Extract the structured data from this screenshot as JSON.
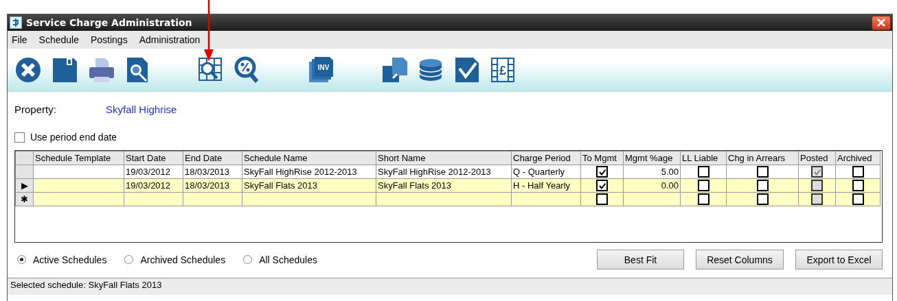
{
  "window": {
    "title": "Service Charge Administration"
  },
  "menu": [
    {
      "label": "File"
    },
    {
      "label": "Schedule"
    },
    {
      "label": "Postings"
    },
    {
      "label": "Administration"
    }
  ],
  "toolbar": [
    [
      {
        "kind": "close"
      },
      {
        "kind": "save"
      },
      {
        "kind": "print"
      },
      {
        "kind": "preview"
      }
    ],
    [
      {
        "kind": "grid-search"
      },
      {
        "kind": "percent-search"
      }
    ],
    [
      {
        "kind": "invoices",
        "label": "INV"
      }
    ],
    [
      {
        "kind": "documents"
      },
      {
        "kind": "coins"
      },
      {
        "kind": "approve"
      },
      {
        "kind": "pound-grid",
        "label": "£"
      }
    ]
  ],
  "property": {
    "label": "Property:",
    "value": "Skyfall Highrise"
  },
  "use_period_end_date": {
    "label": "Use period end date",
    "checked": false
  },
  "table": {
    "columns": [
      "Schedule Template",
      "Start Date",
      "End Date",
      "Schedule Name",
      "Short Name",
      "Charge Period",
      "To Mgmt",
      "Mgmt %age",
      "LL Liable",
      "Chg in Arrears",
      "Posted",
      "Archived"
    ],
    "rows": [
      {
        "marker": "",
        "editable": false,
        "cells": [
          {
            "kind": "text",
            "text": ""
          },
          {
            "kind": "text",
            "text": "19/03/2012"
          },
          {
            "kind": "text",
            "text": "18/03/2013"
          },
          {
            "kind": "text",
            "text": "SkyFall HighRise 2012-2013"
          },
          {
            "kind": "text",
            "text": "SkyFall HighRise 2012-2013"
          },
          {
            "kind": "text",
            "text": "Q - Quarterly"
          },
          {
            "kind": "check",
            "checked": true,
            "disabled": false
          },
          {
            "kind": "number",
            "text": "5.00"
          },
          {
            "kind": "check",
            "checked": false,
            "disabled": false
          },
          {
            "kind": "check",
            "checked": false,
            "disabled": false
          },
          {
            "kind": "check",
            "checked": true,
            "disabled": true
          },
          {
            "kind": "check",
            "checked": false,
            "disabled": false
          }
        ]
      },
      {
        "marker": "▶",
        "editable": true,
        "cells": [
          {
            "kind": "text",
            "text": ""
          },
          {
            "kind": "text",
            "text": "19/03/2012"
          },
          {
            "kind": "text",
            "text": "18/03/2013"
          },
          {
            "kind": "text",
            "text": "SkyFall Flats 2013"
          },
          {
            "kind": "text",
            "text": "SkyFall Flats 2013"
          },
          {
            "kind": "text",
            "text": "H - Half Yearly"
          },
          {
            "kind": "check",
            "checked": true,
            "disabled": false
          },
          {
            "kind": "number",
            "text": "0.00"
          },
          {
            "kind": "check",
            "checked": false,
            "disabled": false
          },
          {
            "kind": "check",
            "checked": false,
            "disabled": false
          },
          {
            "kind": "check",
            "checked": false,
            "disabled": true
          },
          {
            "kind": "check",
            "checked": false,
            "disabled": false
          }
        ]
      },
      {
        "marker": "✱",
        "editable": true,
        "cells": [
          {
            "kind": "text",
            "text": ""
          },
          {
            "kind": "text",
            "text": ""
          },
          {
            "kind": "text",
            "text": ""
          },
          {
            "kind": "text",
            "text": ""
          },
          {
            "kind": "text",
            "text": ""
          },
          {
            "kind": "text",
            "text": ""
          },
          {
            "kind": "check",
            "checked": false,
            "disabled": false
          },
          {
            "kind": "number",
            "text": ""
          },
          {
            "kind": "check",
            "checked": false,
            "disabled": false
          },
          {
            "kind": "check",
            "checked": false,
            "disabled": false
          },
          {
            "kind": "check",
            "checked": false,
            "disabled": true
          },
          {
            "kind": "check",
            "checked": false,
            "disabled": false
          }
        ]
      }
    ]
  },
  "filters": [
    {
      "label": "Active Schedules",
      "selected": true
    },
    {
      "label": "Archived Schedules",
      "selected": false
    },
    {
      "label": "All Schedules",
      "selected": false
    }
  ],
  "buttons": [
    "Best Fit",
    "Reset Columns",
    "Export to Excel"
  ],
  "status_bar": "Selected schedule: SkyFall Flats 2013"
}
